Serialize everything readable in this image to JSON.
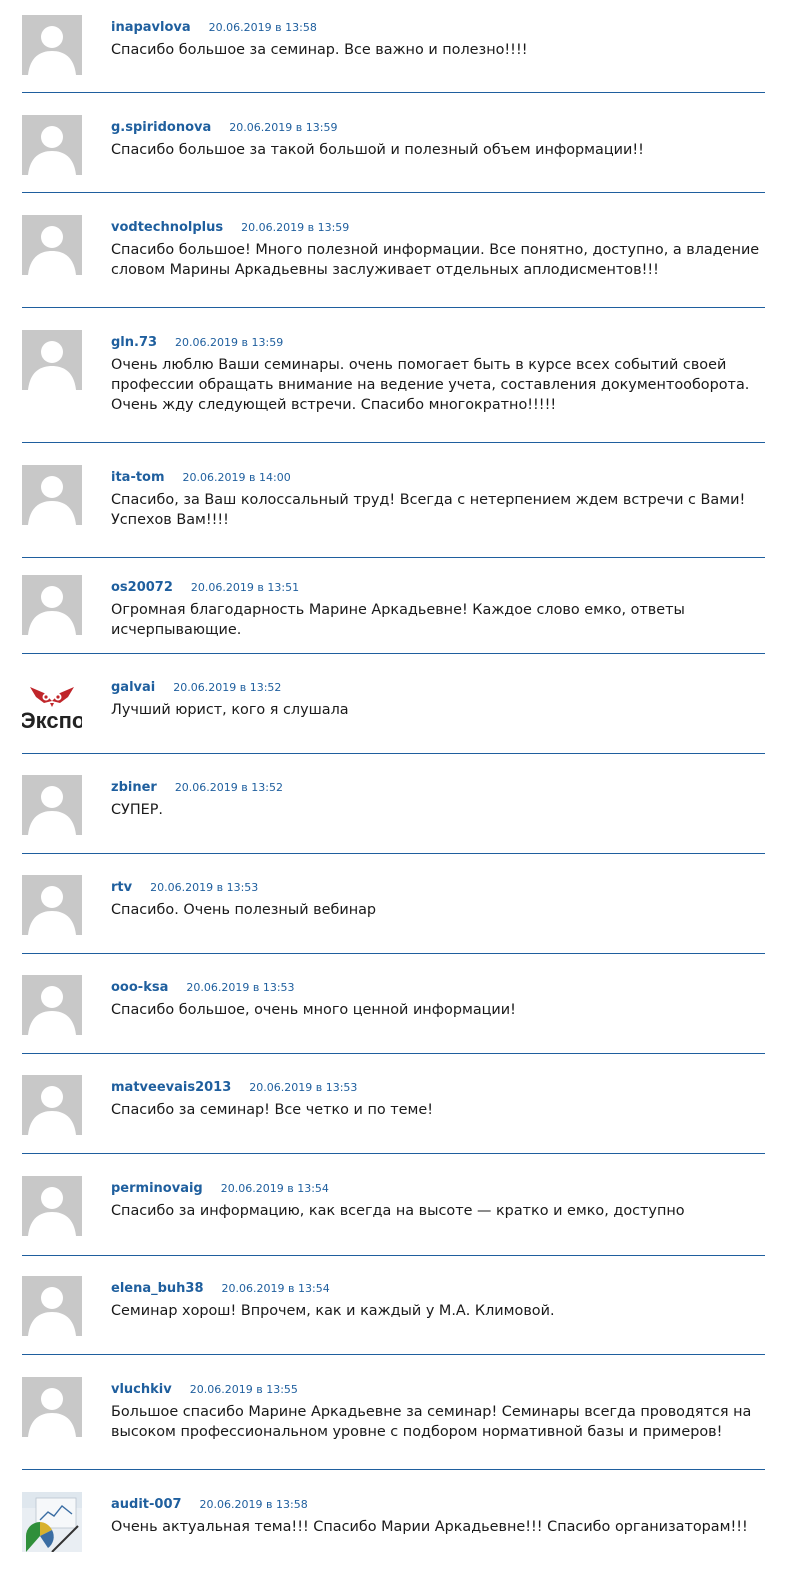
{
  "comments": [
    {
      "author": "inapavlova",
      "date": "20.06.2019 в 13:58",
      "text": "Спасибо большое за семинар. Все важно и полезно!!!!",
      "avatar": "default-avatar"
    },
    {
      "author": "g.spiridonova",
      "date": "20.06.2019 в 13:59",
      "text": "Спасибо большое за такой большой и полезный объем информации!!",
      "avatar": "default-avatar"
    },
    {
      "author": "vodtechnolplus",
      "date": "20.06.2019 в 13:59",
      "text": "Спасибо большое! Много полезной информации. Все понятно, доступно, а владение словом Марины Аркадьевны заслуживает отдельных аплодисментов!!!",
      "avatar": "default-avatar"
    },
    {
      "author": "gln.73",
      "date": "20.06.2019 в 13:59",
      "text": "Очень люблю Ваши семинары. очень помогает быть в курсе всех событий своей профессии обращать внимание на ведение учета, составления документооборота. Очень жду следующей встречи. Спасибо многократно!!!!!",
      "avatar": "default-avatar"
    },
    {
      "author": "ita-tom",
      "date": "20.06.2019 в 14:00",
      "text": "Спасибо, за Ваш колоссальный труд! Всегда с нетерпением ждем встречи с Вами! Успехов Вам!!!!",
      "avatar": "default-avatar"
    },
    {
      "author": "os20072",
      "date": "20.06.2019 в 13:51",
      "text": "Огромная благодарность Марине Аркадьевне! Каждое слово емко, ответы исчерпывающие.",
      "avatar": "default-avatar"
    },
    {
      "author": "galvai",
      "date": "20.06.2019 в 13:52",
      "text": "Лучший юрист, кого я слушала",
      "avatar": "logo-avatar",
      "avatar_text": "Экспо"
    },
    {
      "author": "zbiner",
      "date": "20.06.2019 в 13:52",
      "text": "СУПЕР.",
      "avatar": "default-avatar"
    },
    {
      "author": "rtv",
      "date": "20.06.2019 в 13:53",
      "text": "Спасибо. Очень полезный вебинар",
      "avatar": "default-avatar"
    },
    {
      "author": "ooo-ksa",
      "date": "20.06.2019 в 13:53",
      "text": "Спасибо большое, очень много ценной информации!",
      "avatar": "default-avatar"
    },
    {
      "author": "matveevais2013",
      "date": "20.06.2019 в 13:53",
      "text": "Спасибо за семинар! Все четко и по теме!",
      "avatar": "default-avatar"
    },
    {
      "author": "perminovaig",
      "date": "20.06.2019 в 13:54",
      "text": "Спасибо за информацию, как всегда на высоте — кратко и емко, доступно",
      "avatar": "default-avatar"
    },
    {
      "author": "elena_buh38",
      "date": "20.06.2019 в 13:54",
      "text": "Семинар хорош! Впрочем, как и каждый у М.А. Климовой.",
      "avatar": "default-avatar"
    },
    {
      "author": "vluchkiv",
      "date": "20.06.2019 в 13:55",
      "text": "Большое спасибо Марине Аркадьевне за семинар! Семинары всегда проводятся на высоком профессиональном уровне с подбором нормативной базы и примеров!",
      "avatar": "default-avatar"
    },
    {
      "author": "audit-007",
      "date": "20.06.2019 в 13:58",
      "text": "Очень актуальная тема!!! Спасибо Марии Аркадьевне!!! Спасибо организаторам!!!",
      "avatar": "photo-avatar"
    }
  ],
  "colors": {
    "link": "#1f5f9e",
    "divider": "#1f5f9e",
    "avatar_bg": "#c8c8c8",
    "text": "#1a1a1a"
  }
}
